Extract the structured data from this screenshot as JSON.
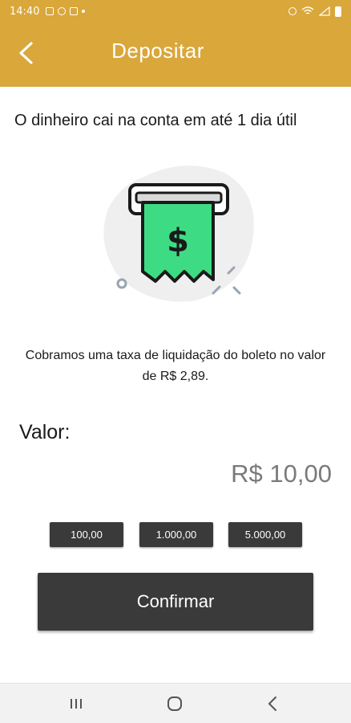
{
  "status_bar": {
    "time": "14:40",
    "icons_left": [
      "image-icon",
      "whatsapp-icon",
      "cast-icon",
      "dot-icon"
    ],
    "icons_right": [
      "alarm-icon",
      "wifi-icon",
      "signal-icon",
      "battery-icon"
    ]
  },
  "app_bar": {
    "title": "Depositar",
    "back_icon": "chevron-left-icon"
  },
  "headline": "O dinheiro cai na conta em até 1 dia útil",
  "illustration": {
    "icon": "boleto-dollar-receipt-icon",
    "symbol": "$"
  },
  "fee_text": "Cobramos uma taxa de liquidação do boleto no valor de R$ 2,89.",
  "valor": {
    "label": "Valor:",
    "amount": "R$ 10,00"
  },
  "quick_amounts": [
    "100,00",
    "1.000,00",
    "5.000,00"
  ],
  "confirm_label": "Confirmar",
  "colors": {
    "brand": "#d9a73a",
    "button": "#3a3a3a",
    "receipt_green": "#3ddc84",
    "amount_gray": "#7a7a7a"
  },
  "nav_bar": {
    "recents_icon": "recents-icon",
    "home_icon": "home-icon",
    "back_icon": "back-icon"
  }
}
